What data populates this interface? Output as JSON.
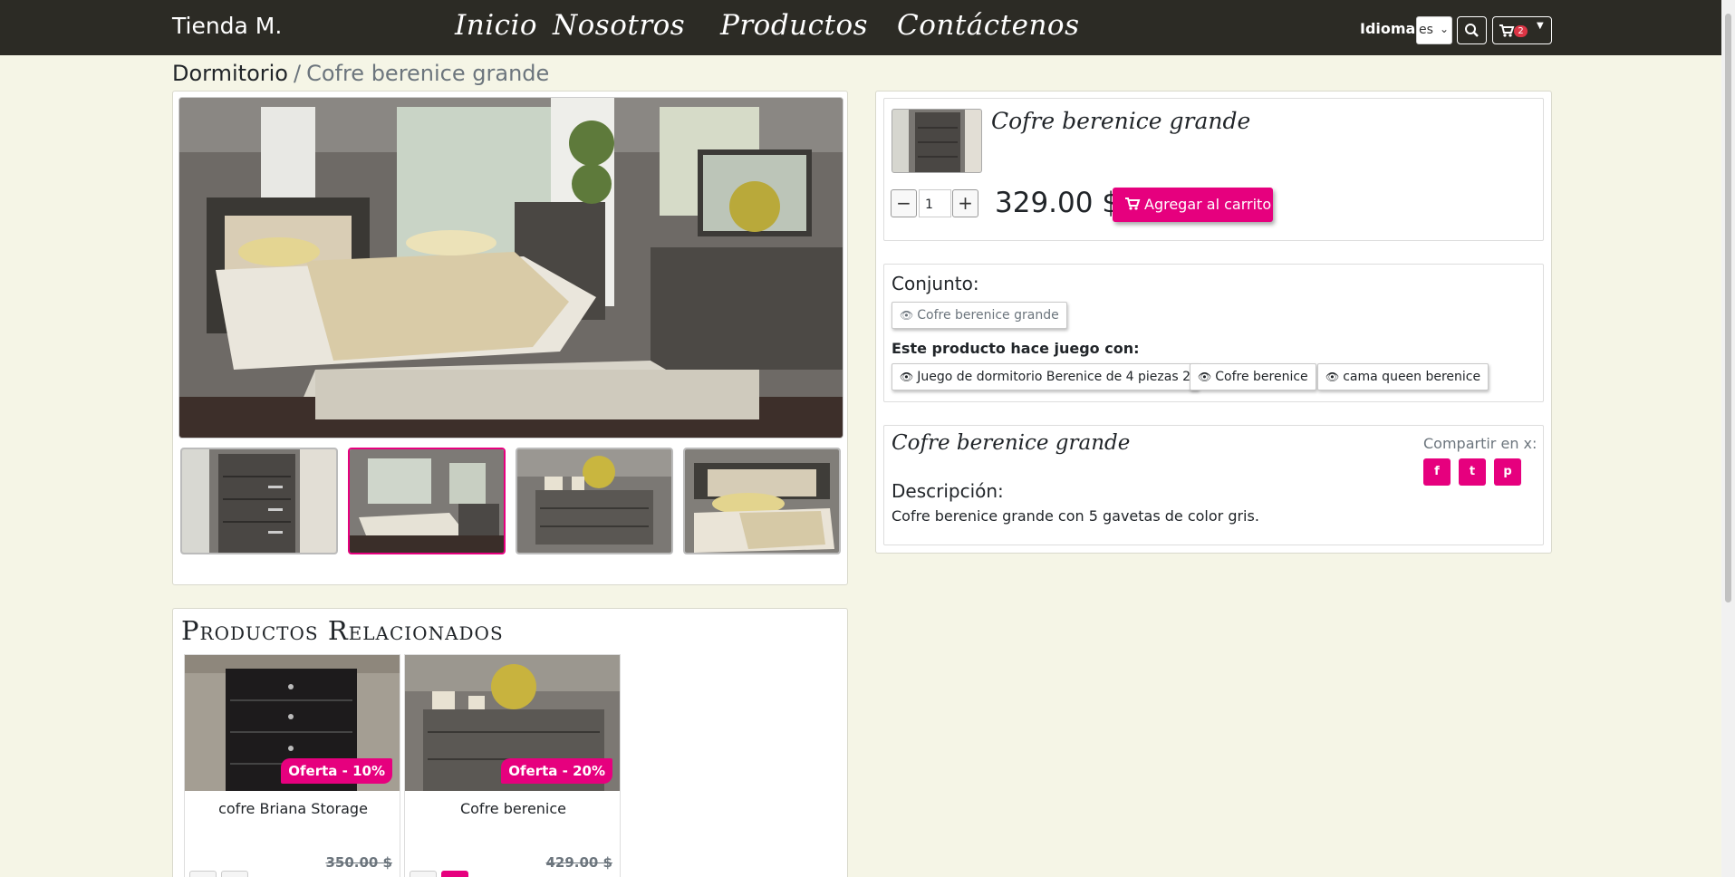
{
  "navbar": {
    "brand": "Tienda M.",
    "links": [
      "Inicio",
      "Nosotros",
      "Productos",
      "Contáctenos"
    ],
    "language_label": "Idioma:",
    "language_value": "es",
    "cart_count": "2"
  },
  "breadcrumb": {
    "category": "Dormitorio",
    "separator": "/",
    "current": "Cofre berenice grande"
  },
  "product": {
    "title": "Cofre berenice grande",
    "quantity": "1",
    "price": "329.00 $",
    "add_to_cart": "Agregar al carrito",
    "set_label": "Conjunto:",
    "set_items": [
      "Cofre berenice grande"
    ],
    "matches_label": "Este producto hace juego con:",
    "matches": [
      "Juego de dormitorio Berenice de 4 piezas 2",
      "Cofre berenice",
      "cama queen berenice"
    ],
    "share_label": "Compartir en x:",
    "description_heading": "Descripción:",
    "description": "Cofre berenice grande con 5 gavetas de color gris."
  },
  "related": {
    "title": "Productos Relacionados",
    "items": [
      {
        "name": "cofre Briana Storage",
        "offer": "Oferta - 10%",
        "old_price": "350.00 $"
      },
      {
        "name": "Cofre berenice",
        "offer": "Oferta - 20%",
        "old_price": "429.00 $"
      }
    ]
  },
  "colors": {
    "navbar": "#2c2b25",
    "background": "#f5f5e6",
    "accent": "#e6007e"
  }
}
